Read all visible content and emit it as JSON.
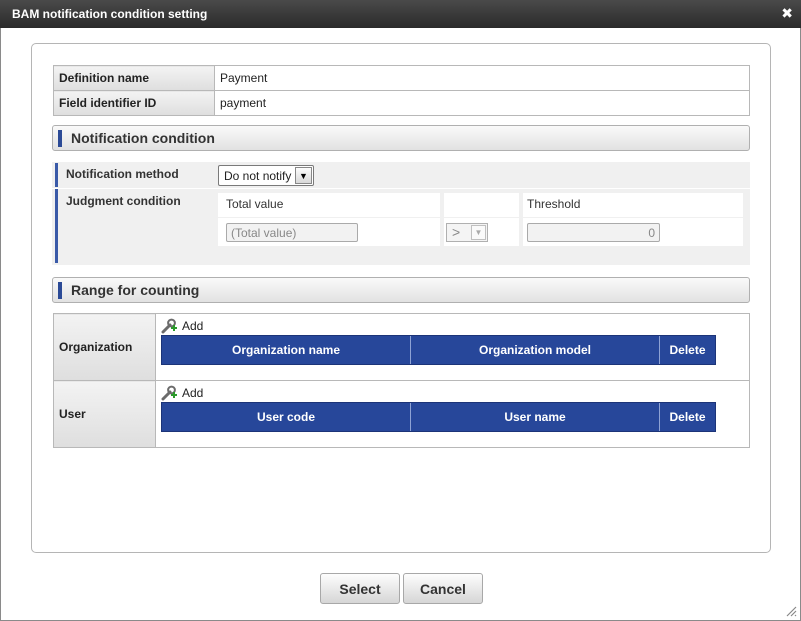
{
  "window": {
    "title": "BAM notification condition setting",
    "close_symbol": "✖"
  },
  "definition": {
    "rows": [
      {
        "label": "Definition name",
        "value": "Payment"
      },
      {
        "label": "Field identifier ID",
        "value": "payment"
      }
    ]
  },
  "notification": {
    "section_title": "Notification condition",
    "method_label": "Notification method",
    "method_selected": "Do not notify",
    "judgment_label": "Judgment condition",
    "total_value_header": "Total value",
    "threshold_header": "Threshold",
    "total_value_placeholder": "(Total value)",
    "operator": ">",
    "threshold_value": "0"
  },
  "range": {
    "section_title": "Range for counting",
    "organization": {
      "label": "Organization",
      "add_label": "Add",
      "columns": [
        "Organization name",
        "Organization model",
        "Delete"
      ]
    },
    "user": {
      "label": "User",
      "add_label": "Add",
      "columns": [
        "User code",
        "User name",
        "Delete"
      ]
    }
  },
  "buttons": {
    "select": "Select",
    "cancel": "Cancel"
  },
  "colors": {
    "title_bar": "#333333",
    "grid_header": "#27479a",
    "section_accent": "#2b4a96"
  },
  "icons": {
    "add": "wrench-add-icon",
    "close": "close-icon",
    "resize": "resize-grip-icon"
  }
}
